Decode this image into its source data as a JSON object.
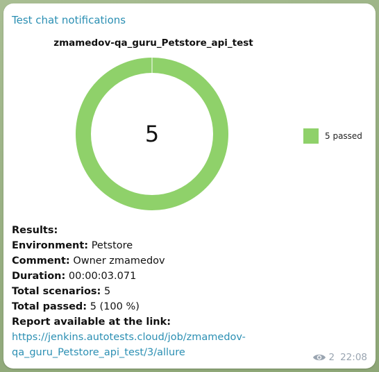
{
  "message": {
    "sender": "Test chat notifications",
    "time": "22:08",
    "views": "2"
  },
  "chart_data": {
    "type": "pie",
    "title": "zmamedov-qa_guru_Petstore_api_test",
    "center_label": "5",
    "categories": [
      "passed"
    ],
    "values": [
      5
    ],
    "legend": [
      {
        "label": "5 passed",
        "color": "#8fd16a"
      }
    ],
    "legend_position": "right"
  },
  "report": {
    "results_label": "Results:",
    "environment_label": "Environment:",
    "environment_value": " Petstore",
    "comment_label": "Comment:",
    "comment_value": " Owner zmamedov",
    "duration_label": "Duration:",
    "duration_value": " 00:00:03.071",
    "total_scenarios_label": "Total scenarios:",
    "total_scenarios_value": " 5",
    "total_passed_label": "Total passed:",
    "total_passed_value": " 5 (100 %)",
    "report_label": "Report available at the link:",
    "report_link": "https://jenkins.autotests.cloud/job/zmamedov-qa_guru_Petstore_api_test/3/allure"
  },
  "icons": {
    "views": "eye-icon"
  },
  "colors": {
    "passed": "#8fd16a",
    "sender": "#2b8fb3",
    "link": "#2b8fb3",
    "meta": "#9aa5b1"
  }
}
